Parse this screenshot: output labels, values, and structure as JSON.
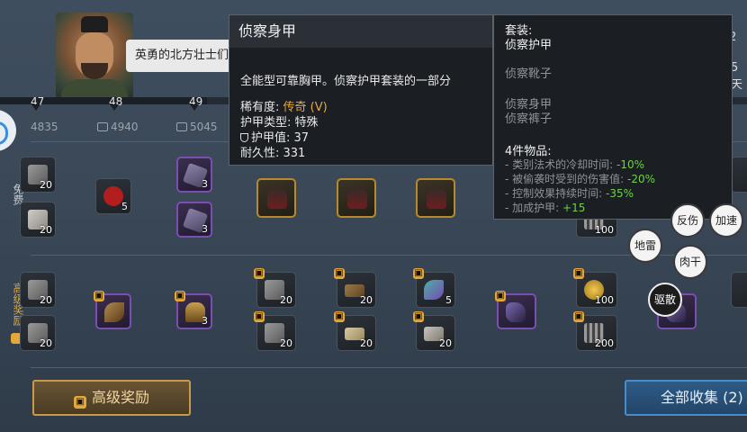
{
  "header": {
    "speech": "英勇的北方壮士们",
    "right_top": "2",
    "right_bottom": "5天"
  },
  "levels": [
    "47",
    "48",
    "49"
  ],
  "xp": [
    "4835",
    "4940",
    "5045"
  ],
  "rows": {
    "free_label": "免费",
    "premium_label": "高级奖励"
  },
  "free_items": [
    {
      "qty": "20"
    },
    {
      "qty": "20"
    },
    {
      "qty": "5"
    },
    {
      "qty": "3"
    },
    {
      "qty": "3"
    },
    {
      "qty": ""
    },
    {
      "qty": ""
    },
    {
      "qty": ""
    },
    {
      "qty": "100"
    }
  ],
  "premium_items": [
    {
      "qty": "20"
    },
    {
      "qty": "20"
    },
    {
      "qty": ""
    },
    {
      "qty": "3"
    },
    {
      "qty": "20"
    },
    {
      "qty": "20"
    },
    {
      "qty": "20"
    },
    {
      "qty": "20"
    },
    {
      "qty": "5"
    },
    {
      "qty": "20"
    },
    {
      "qty": ""
    },
    {
      "qty": "100"
    },
    {
      "qty": "200"
    },
    {
      "qty": ""
    }
  ],
  "tooltip_item": {
    "title": "侦察身甲",
    "description": "全能型可靠胸甲。侦察护甲套装的一部分",
    "rarity_label": "稀有度:",
    "rarity_value": "传奇 (V)",
    "armor_type": "护甲类型: 特殊",
    "armor_value": "护甲值: 37",
    "durability": "耐久性: 331"
  },
  "tooltip_set": {
    "set_label": "套装:",
    "set_name": "侦察护甲",
    "pieces": [
      "侦察靴子",
      "侦察身甲",
      "侦察裤子"
    ],
    "bonus_title": "4件物品:",
    "bonuses": [
      {
        "label": "- 类别法术的冷却时间:",
        "value": "-10%"
      },
      {
        "label": "- 被偷袭时受到的伤害值:",
        "value": "-20%"
      },
      {
        "label": "- 控制效果持续时间:",
        "value": "-35%"
      },
      {
        "label": "- 加成护甲:",
        "value": "+15"
      }
    ]
  },
  "actions": {
    "fanshang": "反伤",
    "jiasu": "加速",
    "dilei": "地雷",
    "rougan": "肉干",
    "qusan": "驱散"
  },
  "buttons": {
    "premium": "高级奖励",
    "collect_all": "全部收集 (2)"
  }
}
